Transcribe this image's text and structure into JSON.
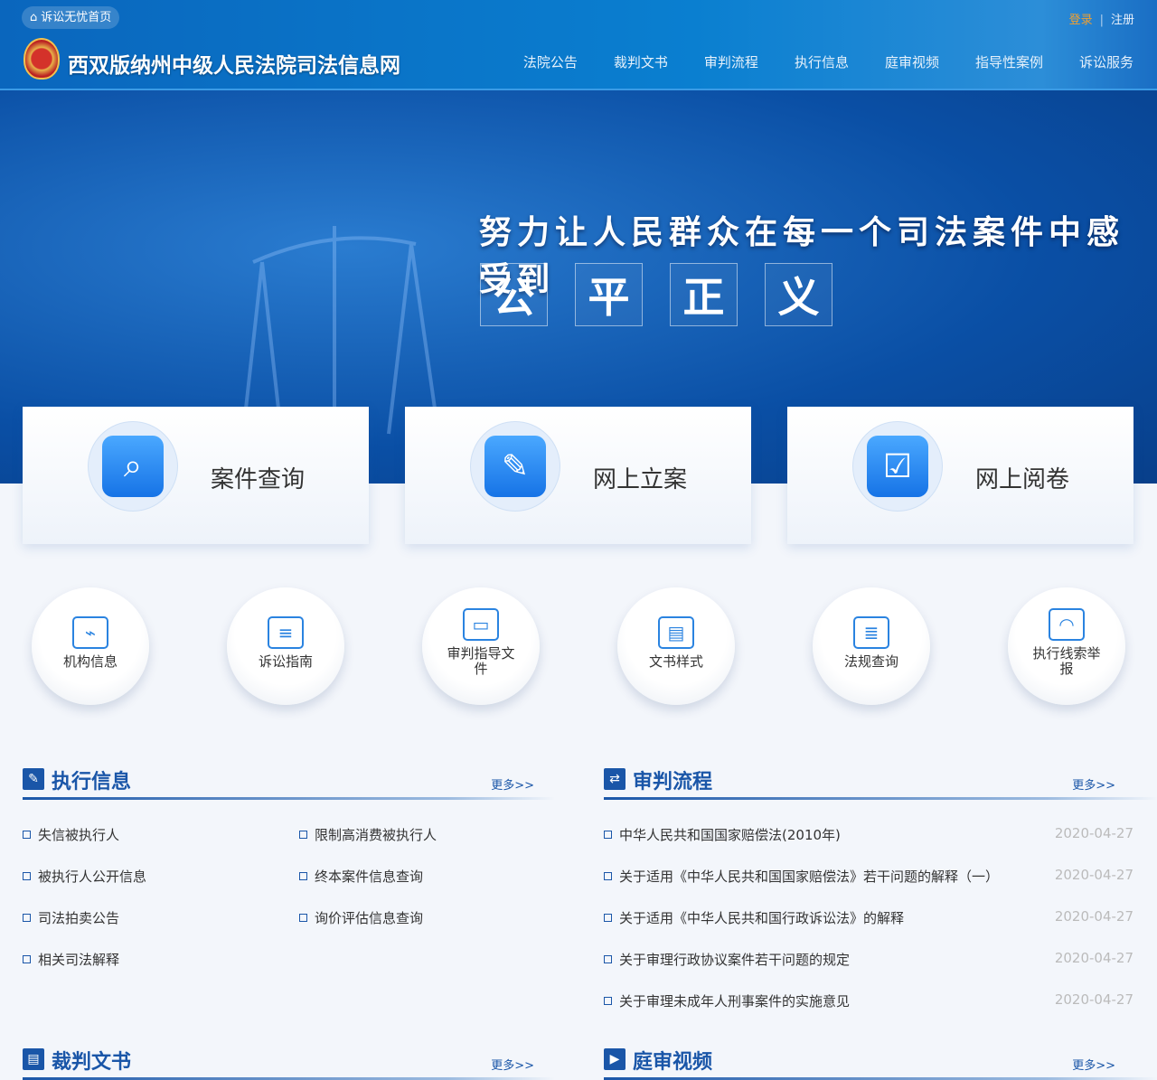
{
  "header": {
    "home_link": "诉讼无忧首页",
    "site_title": "西双版纳州中级人民法院司法信息网",
    "login": "登录",
    "separator": "|",
    "register": "注册",
    "nav": [
      "法院公告",
      "裁判文书",
      "审判流程",
      "执行信息",
      "庭审视频",
      "指导性案例",
      "诉讼服务"
    ]
  },
  "banner": {
    "slogan": "努力让人民群众在每一个司法案件中感受到",
    "fairness": [
      "公",
      "平",
      "正",
      "义"
    ]
  },
  "cards": [
    {
      "label": "案件查询",
      "icon": "search-icon"
    },
    {
      "label": "网上立案",
      "icon": "edit-icon"
    },
    {
      "label": "网上阅卷",
      "icon": "document-check-icon"
    }
  ],
  "quick_links": [
    {
      "label": "机构信息",
      "icon": "monitor-icon"
    },
    {
      "label": "诉讼指南",
      "icon": "guide-icon"
    },
    {
      "label": "审判指导文件",
      "icon": "briefcase-icon"
    },
    {
      "label": "文书样式",
      "icon": "documents-icon"
    },
    {
      "label": "法规查询",
      "icon": "law-search-icon"
    },
    {
      "label": "执行线索举报",
      "icon": "alarm-icon"
    }
  ],
  "execution": {
    "title": "执行信息",
    "more": "更多>>",
    "items": [
      "失信被执行人",
      "限制高消费被执行人",
      "被执行人公开信息",
      "终本案件信息查询",
      "司法拍卖公告",
      "询价评估信息查询",
      "相关司法解释"
    ]
  },
  "trial_process": {
    "title": "审判流程",
    "more": "更多>>",
    "items": [
      {
        "title": "中华人民共和国国家赔偿法(2010年)",
        "date": "2020-04-27"
      },
      {
        "title": "关于适用《中华人民共和国国家赔偿法》若干问题的解释（一）",
        "date": "2020-04-27"
      },
      {
        "title": "关于适用《中华人民共和国行政诉讼法》的解释",
        "date": "2020-04-27"
      },
      {
        "title": "关于审理行政协议案件若干问题的规定",
        "date": "2020-04-27"
      },
      {
        "title": "关于审理未成年人刑事案件的实施意见",
        "date": "2020-04-27"
      }
    ]
  },
  "judgments": {
    "title": "裁判文书",
    "more": "更多>>"
  },
  "trial_video": {
    "title": "庭审视频",
    "more": "更多>>"
  }
}
